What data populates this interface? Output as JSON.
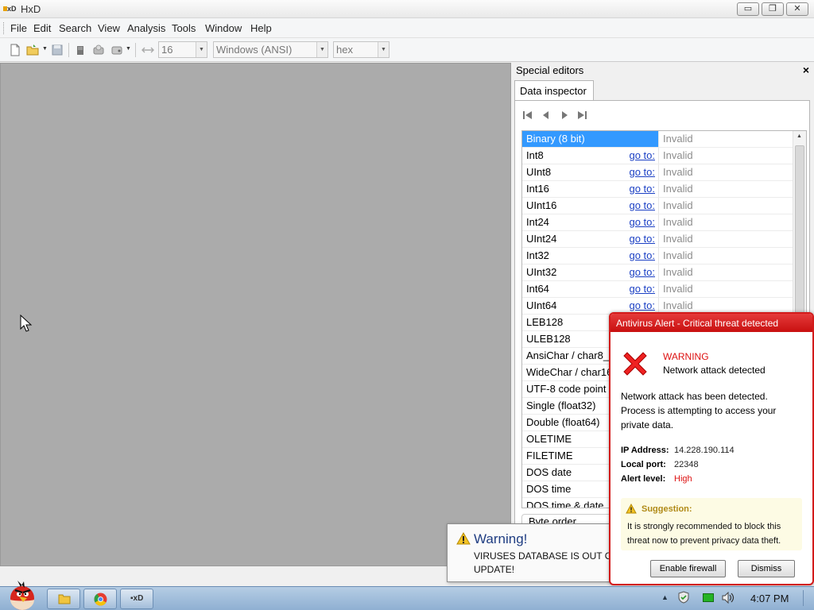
{
  "window": {
    "title": "HxD",
    "controls": {
      "minimize": "▭",
      "restore": "❐",
      "close": "✕"
    }
  },
  "menu": [
    "File",
    "Edit",
    "Search",
    "View",
    "Analysis",
    "Tools",
    "Window",
    "Help"
  ],
  "toolbar": {
    "bytes_per_row": "16",
    "charset": "Windows (ANSI)",
    "offset_base": "hex"
  },
  "panel": {
    "title": "Special editors",
    "close": "×",
    "tab": "Data inspector",
    "goto_label": "go to:",
    "rows": [
      {
        "name": "Binary (8 bit)",
        "value": "Invalid",
        "goto": false,
        "selected": true
      },
      {
        "name": "Int8",
        "value": "Invalid",
        "goto": true
      },
      {
        "name": "UInt8",
        "value": "Invalid",
        "goto": true
      },
      {
        "name": "Int16",
        "value": "Invalid",
        "goto": true
      },
      {
        "name": "UInt16",
        "value": "Invalid",
        "goto": true
      },
      {
        "name": "Int24",
        "value": "Invalid",
        "goto": true
      },
      {
        "name": "UInt24",
        "value": "Invalid",
        "goto": true
      },
      {
        "name": "Int32",
        "value": "Invalid",
        "goto": true
      },
      {
        "name": "UInt32",
        "value": "Invalid",
        "goto": true
      },
      {
        "name": "Int64",
        "value": "Invalid",
        "goto": true
      },
      {
        "name": "UInt64",
        "value": "Invalid",
        "goto": true
      },
      {
        "name": "LEB128",
        "value": "",
        "goto": false
      },
      {
        "name": "ULEB128",
        "value": "",
        "goto": false
      },
      {
        "name": "AnsiChar / char8_t",
        "value": "",
        "goto": false
      },
      {
        "name": "WideChar / char16_t",
        "value": "",
        "goto": false
      },
      {
        "name": "UTF-8 code point",
        "value": "",
        "goto": false
      },
      {
        "name": "Single (float32)",
        "value": "",
        "goto": false
      },
      {
        "name": "Double (float64)",
        "value": "",
        "goto": false
      },
      {
        "name": "OLETIME",
        "value": "",
        "goto": false
      },
      {
        "name": "FILETIME",
        "value": "",
        "goto": false
      },
      {
        "name": "DOS date",
        "value": "",
        "goto": false
      },
      {
        "name": "DOS time",
        "value": "",
        "goto": false
      },
      {
        "name": "DOS time & date",
        "value": "",
        "goto": false
      }
    ],
    "byte_order": "Byte order"
  },
  "warning_popup": {
    "title": "Warning!",
    "text": "VIRUSES DATABASE IS OUT O\nUPDATE!"
  },
  "antivirus": {
    "header": "Antivirus Alert - Critical threat detected",
    "warning": "WARNING",
    "subtitle": "Network attack detected",
    "description": "Network attack has been detected. Process is attempting to access your private data.",
    "ip_label": "IP Address:",
    "ip_value": "14.228.190.114",
    "port_label": "Local port:",
    "port_value": "22348",
    "level_label": "Alert level:",
    "level_value": "High",
    "suggestion_title": "Suggestion:",
    "suggestion_text": "It is strongly recommended to block this threat now to prevent privacy data theft.",
    "enable_button": "Enable firewall",
    "dismiss_button": "Dismiss",
    "accent_color": "#d31a1a"
  },
  "taskbar": {
    "tray_arrow": "▲",
    "clock": "4:07 PM"
  }
}
